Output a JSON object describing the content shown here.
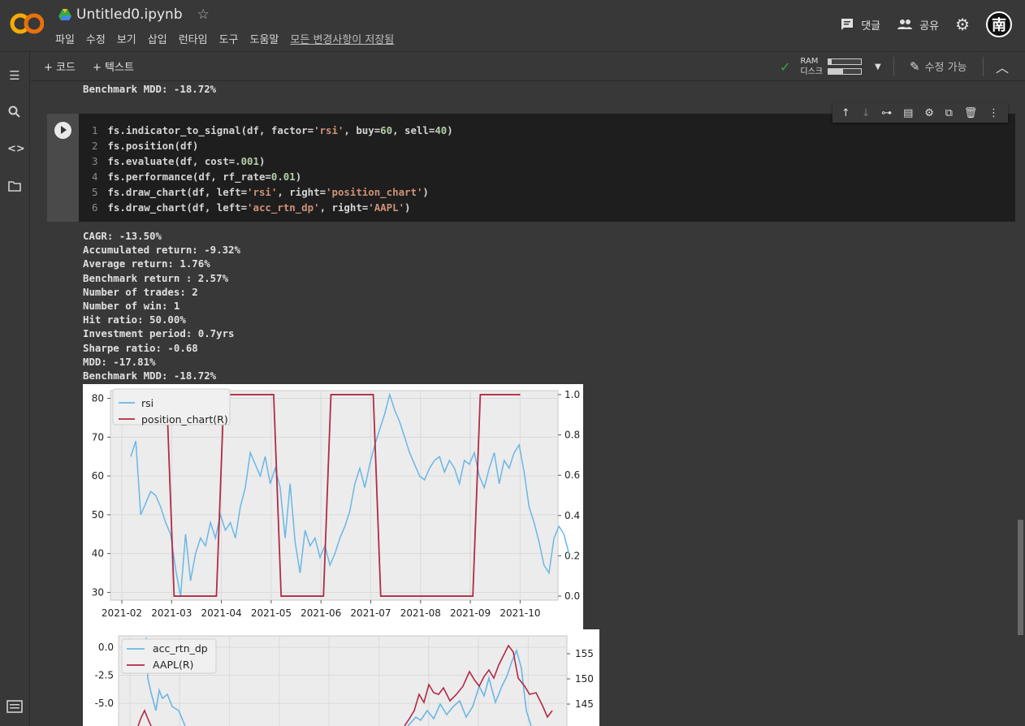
{
  "app": {
    "title": "Untitled0.ipynb",
    "menu": [
      "파일",
      "수정",
      "보기",
      "삽입",
      "런타임",
      "도구",
      "도움말"
    ],
    "saved_status": "모든 변경사항이 저장됨",
    "comment_label": "댓글",
    "share_label": "공유",
    "avatar_text": "南"
  },
  "toolbar": {
    "add_code": "+ 코드",
    "add_text": "+ 텍스트",
    "ram_label": "RAM",
    "disk_label": "디스크",
    "ram_fill": 0.1,
    "disk_fill": 0.45,
    "edit_mode": "수정 가능"
  },
  "previous_output": "Benchmark MDD: -18.72%",
  "code_lines": [
    "fs.indicator_to_signal(df, factor='rsi', buy=60, sell=40)",
    "fs.position(df)",
    "fs.evaluate(df, cost=.001)",
    "fs.performance(df, rf_rate=0.01)",
    "fs.draw_chart(df, left='rsi', right='position_chart')",
    "fs.draw_chart(df, left='acc_rtn_dp', right='AAPL')"
  ],
  "output_lines": [
    "CAGR: -13.50%",
    "Accumulated return: -9.32%",
    "Average return: 1.76%",
    "Benchmark return : 2.57%",
    "Number of trades: 2",
    "Number of win: 1",
    "Hit ratio: 50.00%",
    "Investment period: 0.7yrs",
    "Sharpe ratio: -0.68",
    "MDD: -17.81%",
    "Benchmark MDD: -18.72%"
  ],
  "chart_data": [
    {
      "type": "line",
      "x_ticks": [
        "2021-02",
        "2021-03",
        "2021-04",
        "2021-05",
        "2021-06",
        "2021-07",
        "2021-08",
        "2021-09",
        "2021-10"
      ],
      "y_left_ticks": [
        30,
        40,
        50,
        60,
        70,
        80
      ],
      "y_right_ticks": [
        "0.0",
        "0.2",
        "0.4",
        "0.6",
        "0.8",
        "1.0"
      ],
      "ylim_left": [
        28,
        82
      ],
      "ylim_right": [
        -0.02,
        1.02
      ],
      "xlim": [
        0,
        9
      ],
      "legend": [
        "rsi",
        "position_chart(R)"
      ],
      "legend_placement": "top-left",
      "grid": true,
      "series": [
        {
          "name": "rsi",
          "axis": "left",
          "color": "#6ab7e6",
          "x": [
            0.18,
            0.28,
            0.38,
            0.48,
            0.58,
            0.68,
            0.78,
            0.88,
            0.98,
            1.08,
            1.18,
            1.28,
            1.38,
            1.48,
            1.58,
            1.68,
            1.78,
            1.88,
            1.98,
            2.08,
            2.18,
            2.28,
            2.38,
            2.48,
            2.58,
            2.68,
            2.78,
            2.88,
            2.98,
            3.08,
            3.18,
            3.28,
            3.38,
            3.48,
            3.58,
            3.68,
            3.78,
            3.88,
            3.98,
            4.08,
            4.18,
            4.28,
            4.38,
            4.48,
            4.58,
            4.68,
            4.78,
            4.88,
            4.98,
            5.08,
            5.18,
            5.28,
            5.38,
            5.48,
            5.58,
            5.68,
            5.78,
            5.88,
            5.98,
            6.08,
            6.18,
            6.28,
            6.38,
            6.48,
            6.58,
            6.68,
            6.78,
            6.88,
            6.98,
            7.08,
            7.18,
            7.28,
            7.38,
            7.48,
            7.58,
            7.68,
            7.78,
            7.88,
            7.98,
            8.08,
            8.18,
            8.28,
            8.38,
            8.48,
            8.58,
            8.68,
            8.78,
            8.88,
            8.98
          ],
          "y": [
            65,
            69,
            50,
            53,
            56,
            55,
            52,
            48,
            45,
            36,
            29,
            45,
            33,
            40,
            44,
            42,
            48,
            44,
            50,
            46,
            48,
            44,
            52,
            57,
            66,
            63,
            60,
            65,
            58,
            62,
            57,
            44,
            58,
            43,
            35,
            46,
            42,
            44,
            39,
            42,
            37,
            40,
            44,
            47,
            51,
            58,
            62,
            57,
            63,
            68,
            72,
            76,
            81,
            77,
            74,
            70,
            66,
            63,
            60,
            59,
            62,
            64,
            65,
            61,
            64,
            62,
            58,
            64,
            63,
            66,
            60,
            57,
            62,
            66,
            58,
            64,
            62,
            66,
            68,
            61,
            52,
            48,
            43,
            37,
            35,
            44,
            47,
            45,
            40
          ],
          "values_note": ""
        },
        {
          "name": "position_chart(R)",
          "axis": "right",
          "color": "#b22a47",
          "x": [
            0.0,
            0.9,
            1.05,
            1.9,
            2.05,
            3.05,
            3.2,
            4.05,
            4.2,
            5.05,
            5.2,
            7.05,
            7.2,
            8.0
          ],
          "y": [
            1,
            1,
            0,
            0,
            1,
            1,
            0,
            0,
            1,
            1,
            0,
            0,
            1,
            1
          ]
        }
      ]
    },
    {
      "type": "line",
      "y_left_ticks": [
        "0.0",
        "-2.5",
        "-5.0"
      ],
      "y_right_ticks": [
        "155",
        "150",
        "145"
      ],
      "legend": [
        "acc_rtn_dp",
        "AAPL(R)"
      ],
      "legend_placement": "top-left",
      "grid": true,
      "series": [
        {
          "name": "acc_rtn_dp",
          "axis": "left",
          "color": "#6ab7e6"
        },
        {
          "name": "AAPL(R)",
          "axis": "right",
          "color": "#b22a47"
        }
      ]
    }
  ]
}
